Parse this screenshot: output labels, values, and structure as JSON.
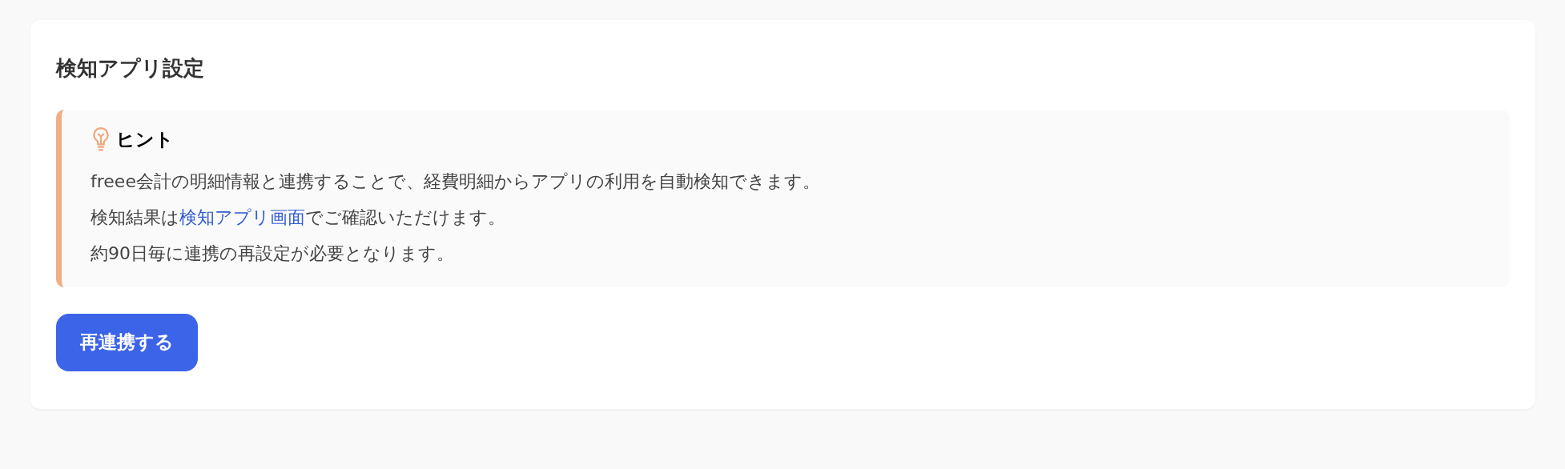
{
  "card": {
    "title": "検知アプリ設定",
    "hint": {
      "title": "ヒント",
      "lines": [
        {
          "kind": "text",
          "text": "freee会計の明細情報と連携することで、経費明細からアプリの利用を自動検知できます。"
        },
        {
          "kind": "link",
          "before": "検知結果は",
          "link": "検知アプリ画面",
          "after": "でご確認いただけます。"
        },
        {
          "kind": "text",
          "text": "約90日毎に連携の再設定が必要となります。"
        }
      ]
    },
    "button": "再連携する"
  }
}
